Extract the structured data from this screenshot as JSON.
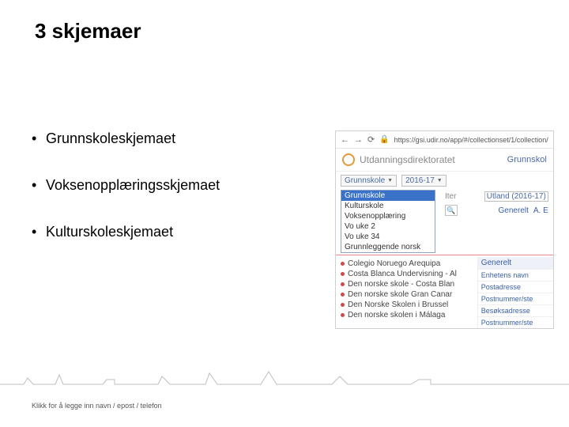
{
  "title": "3 skjemaer",
  "bullets": [
    "Grunnskoleskjemaet",
    "Voksenopplæringsskjemaet",
    "Kulturskoleskjemaet"
  ],
  "screenshot": {
    "nav": {
      "back": "←",
      "forward": "→",
      "reload": "⟳"
    },
    "lock_icon": "🔒",
    "url": "https://gsi.udir.no/app/#/collectionset/1/collection/",
    "brand": "Utdanningsdirektoratet",
    "brand_cut": "Grunnskol",
    "selector_left": "Grunnskole",
    "selector_year": "2016-17",
    "dropdown_selected": "Grunnskole",
    "dropdown": [
      "Grunnskole",
      "Kulturskole",
      "Voksenopplæring",
      "Vo uke 2",
      "Vo uke 34",
      "Grunnleggende norsk"
    ],
    "filter_cut": "Iter",
    "utland": "Utland (2016-17)",
    "links": {
      "generelt": "Generelt",
      "a_e": "A. E"
    },
    "panel_header": "Generelt",
    "panel_labels": [
      "Enhetens navn",
      "Postadresse",
      "Postnummer/ste",
      "Besøksadresse",
      "Postnummer/ste"
    ],
    "list": [
      "Colegio Noruego  Arequipa",
      "Costa Blanca Undervisning - Al",
      "Den norske skole - Costa Blan",
      "Den norske skole  Gran Canar",
      "Den Norske Skolen i Brussel",
      "Den norske skolen i Málaga"
    ]
  },
  "presenter_note": "Klikk for å legge inn navn / epost / telefon"
}
